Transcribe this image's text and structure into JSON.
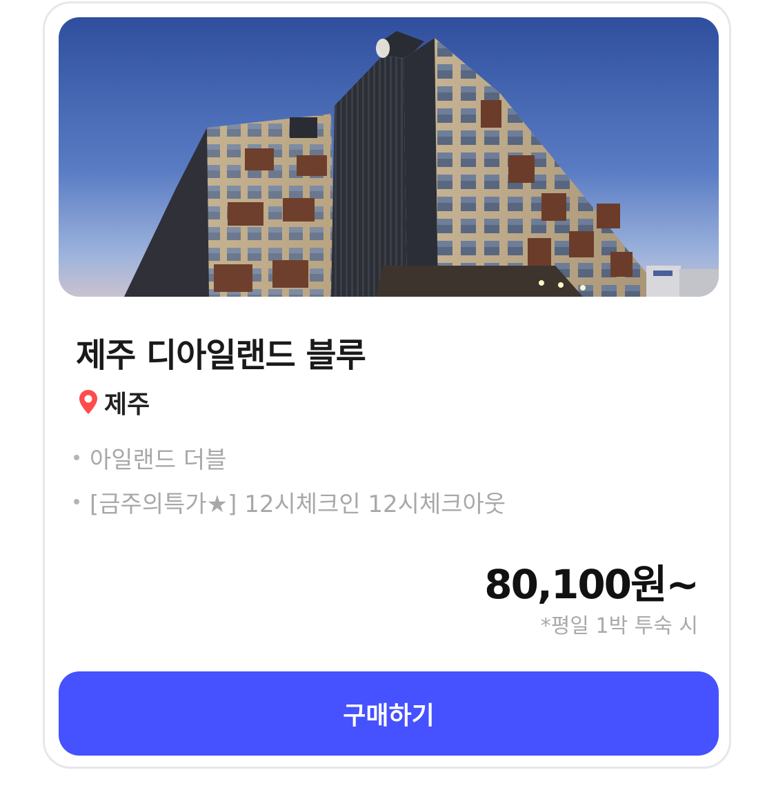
{
  "product": {
    "title": "제주 디아일랜드 블루",
    "location": "제주",
    "location_icon": "map-pin-icon",
    "features": [
      "아일랜드 더블",
      "[금주의특가★]  12시체크인 12시체크아웃"
    ],
    "price": "80,100원~",
    "price_note": "*평일 1박 투숙 시"
  },
  "actions": {
    "buy_label": "구매하기"
  },
  "colors": {
    "accent": "#4651ff",
    "pin": "#ff4b4b",
    "border": "#e6e6ec"
  }
}
